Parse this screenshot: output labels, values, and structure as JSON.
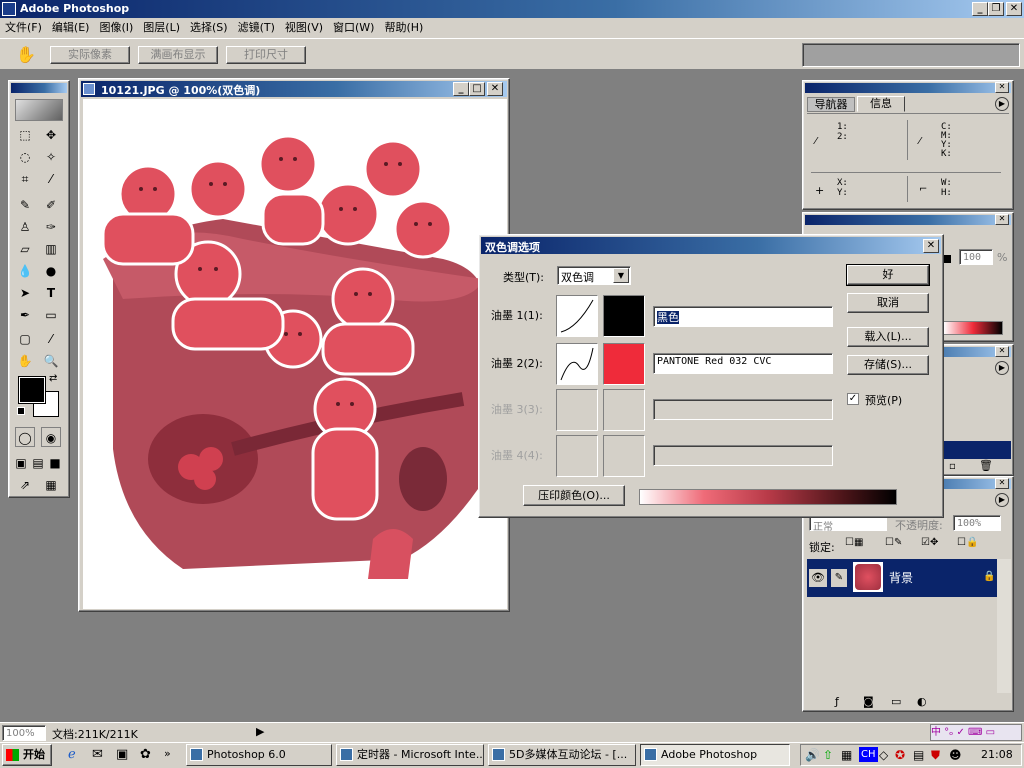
{
  "app": {
    "title": "Adobe Photoshop",
    "menu": [
      "文件(F)",
      "编辑(E)",
      "图像(I)",
      "图层(L)",
      "选择(S)",
      "滤镜(T)",
      "视图(V)",
      "窗口(W)",
      "帮助(H)"
    ]
  },
  "options_bar": {
    "actual_pixels": "实际像素",
    "fit_on_screen": "满画布显示",
    "print_size": "打印尺寸"
  },
  "document": {
    "title": "10121.JPG @ 100%(双色调)"
  },
  "navigator_panel": {
    "tabs": [
      "导航器",
      "信息"
    ],
    "labels_left": [
      "1:",
      "2:"
    ],
    "labels_cmyk": [
      "C:",
      "M:",
      "Y:",
      "K:"
    ],
    "labels_xy": [
      "X:",
      "Y:"
    ],
    "labels_wh": [
      "W:",
      "H:"
    ]
  },
  "duotone_dialog": {
    "title": "双色调选项",
    "type_label": "类型(T):",
    "type_value": "双色调",
    "ink1_label": "油墨 1(1):",
    "ink1_name": "黑色",
    "ink1_color": "#000000",
    "ink2_label": "油墨 2(2):",
    "ink2_name": "PANTONE Red 032 CVC",
    "ink2_color": "#ef2b3a",
    "ink3_label": "油墨 3(3):",
    "ink4_label": "油墨 4(4):",
    "overprint_button": "压印颜色(O)...",
    "ok_button": "好",
    "cancel_button": "取消",
    "load_button": "载入(L)...",
    "save_button": "存储(S)...",
    "preview_label": "预览(P)",
    "preview_checked": true
  },
  "layers_panel": {
    "mode": "正常",
    "opacity_label": "不透明度:",
    "opacity_value": "100%",
    "lock_label": "锁定:",
    "layer_name": "背景"
  },
  "color_panel": {
    "value": "100",
    "unit": "%"
  },
  "status_bar": {
    "zoom": "100%",
    "doc_info": "文档:211K/211K"
  },
  "taskbar": {
    "start": "开始",
    "tasks": [
      "Photoshop 6.0",
      "定时器 - Microsoft Inte...",
      "5D多媒体互动论坛 - [...",
      "Adobe Photoshop"
    ],
    "active_task": 3,
    "clock": "21:08",
    "ime": "CH"
  }
}
